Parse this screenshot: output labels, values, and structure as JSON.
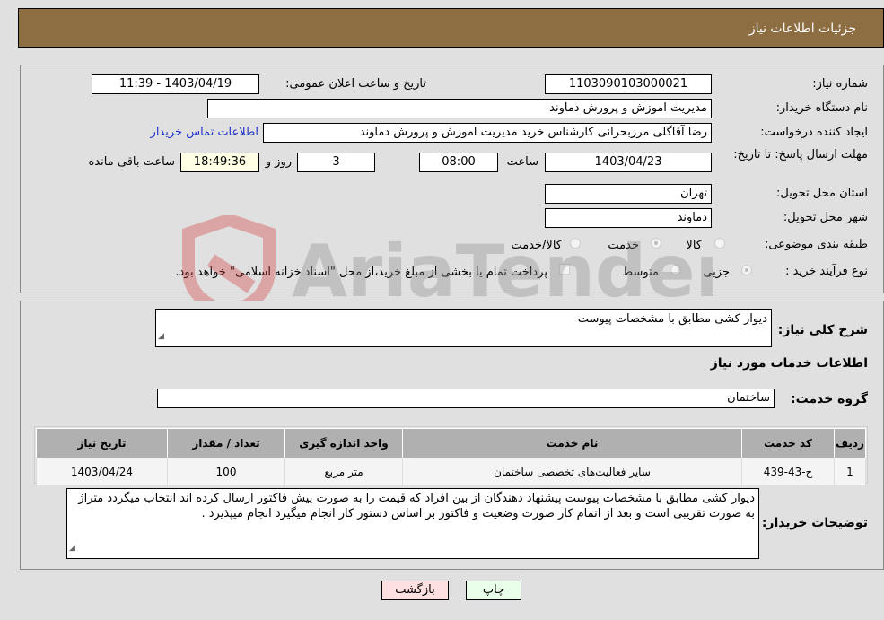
{
  "header": {
    "title": "جزئیات اطلاعات نیاز"
  },
  "form": {
    "need_number_label": "شماره نیاز:",
    "need_number": "1103090103000021",
    "announce_label": "تاریخ و ساعت اعلان عمومی:",
    "announce_value": "1403/04/19 - 11:39",
    "buyer_org_label": "نام دستگاه خریدار:",
    "buyer_org": "مدیریت اموزش و پرورش دماوند",
    "creator_label": "ایجاد کننده درخواست:",
    "creator": "رضا آقاگلی مرزبحرانی کارشناس خرید مدیریت اموزش و پرورش دماوند",
    "contact_link": "اطلاعات تماس خریدار",
    "deadline_label": "مهلت ارسال پاسخ: تا تاریخ:",
    "deadline_date": "1403/04/23",
    "time_label": "ساعت",
    "deadline_time": "08:00",
    "days_value": "3",
    "days_label": "روز و",
    "remaining_time": "18:49:36",
    "remaining_label": "ساعت باقی مانده",
    "province_label": "استان محل تحویل:",
    "province": "تهران",
    "city_label": "شهر محل تحویل:",
    "city": "دماوند",
    "category_label": "طبقه بندی موضوعی:",
    "category_options": [
      "کالا",
      "خدمت",
      "کالا/خدمت"
    ],
    "category_selected": "خدمت",
    "process_label": "نوع فرآیند خرید :",
    "process_options": [
      "جزیی",
      "متوسط"
    ],
    "process_selected": "جزیی",
    "treasury_note": "پرداخت تمام یا بخشی از مبلغ خرید،از محل \"اسناد خزانه اسلامی\" خواهد بود."
  },
  "details": {
    "summary_label": "شرح کلی نیاز:",
    "summary": "دیوار کشی مطابق با مشخصات پیوست",
    "services_title": "اطلاعات خدمات مورد نیاز",
    "service_group_label": "گروه خدمت:",
    "service_group": "ساختمان",
    "table": {
      "headers": [
        "ردیف",
        "کد خدمت",
        "نام خدمت",
        "واحد اندازه گیری",
        "تعداد / مقدار",
        "تاریخ نیاز"
      ],
      "rows": [
        [
          "1",
          "ج-43-439",
          "سایر فعالیت‌های تخصصی ساختمان",
          "متر مربع",
          "100",
          "1403/04/24"
        ]
      ]
    },
    "buyer_notes_label": "توضیحات خریدار:",
    "buyer_notes": "دیوار کشی مطابق با مشخصات پیوست پیشنهاد دهندگان از بین افراد که قیمت را به صورت پیش فاکتور ارسال کرده اند انتخاب میگردد متراژ به صورت تقریبی است و بعد از اتمام کار صورت وضعیت و فاکتور بر اساس دستور کار انجام میگیرد انجام میپذیرد ."
  },
  "buttons": {
    "print": "چاپ",
    "back": "بازگشت"
  },
  "watermark": "AriaTender.neT"
}
